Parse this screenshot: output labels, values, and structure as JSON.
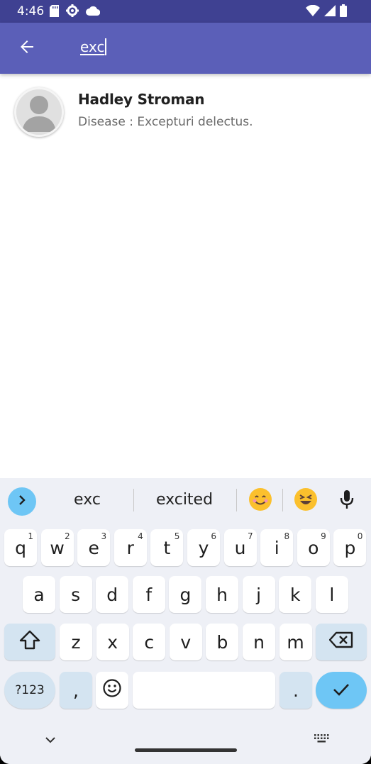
{
  "status_bar": {
    "time": "4:46"
  },
  "search": {
    "query": "exc"
  },
  "results": [
    {
      "name": "Hadley Stroman",
      "subtitle": "Disease : Excepturi delectus."
    }
  ],
  "keyboard": {
    "suggestions": [
      "exc",
      "excited"
    ],
    "row1": [
      {
        "k": "q",
        "h": "1"
      },
      {
        "k": "w",
        "h": "2"
      },
      {
        "k": "e",
        "h": "3"
      },
      {
        "k": "r",
        "h": "4"
      },
      {
        "k": "t",
        "h": "5"
      },
      {
        "k": "y",
        "h": "6"
      },
      {
        "k": "u",
        "h": "7"
      },
      {
        "k": "i",
        "h": "8"
      },
      {
        "k": "o",
        "h": "9"
      },
      {
        "k": "p",
        "h": "0"
      }
    ],
    "row2": [
      "a",
      "s",
      "d",
      "f",
      "g",
      "h",
      "j",
      "k",
      "l"
    ],
    "row3": [
      "z",
      "x",
      "c",
      "v",
      "b",
      "n",
      "m"
    ],
    "symbols_label": "?123",
    "comma_label": ",",
    "period_label": "."
  },
  "colors": {
    "status_bar": "#3f4192",
    "app_bar": "#5b5fb8",
    "accent_key": "#6ec6f5"
  }
}
